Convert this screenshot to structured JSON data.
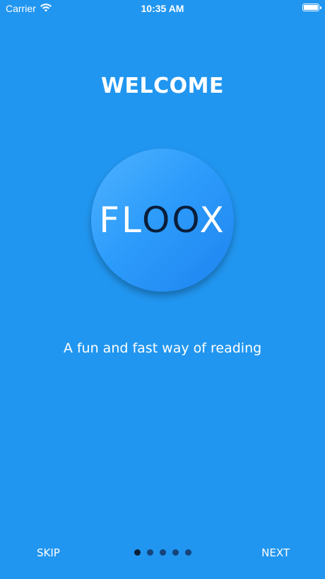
{
  "status_bar": {
    "carrier": "Carrier",
    "time": "10:35 AM",
    "wifi_icon": "wifi-icon",
    "battery_icon": "battery-icon",
    "battery_level": 1.0
  },
  "onboarding": {
    "title": "WELCOME",
    "logo": {
      "text_light_start": "FL",
      "text_dark": "OO",
      "text_light_end": "X"
    },
    "tagline": "A fun and fast way of reading"
  },
  "pager": {
    "total_pages": 5,
    "active_index": 0
  },
  "controls": {
    "skip_label": "SKIP",
    "next_label": "NEXT"
  },
  "colors": {
    "background": "#2196F0",
    "logo_gradient_start": "#4FB3FF",
    "logo_gradient_end": "#1E84F0",
    "dot_color": "#15437A",
    "logo_dark_letters": "#0b1e3a"
  }
}
